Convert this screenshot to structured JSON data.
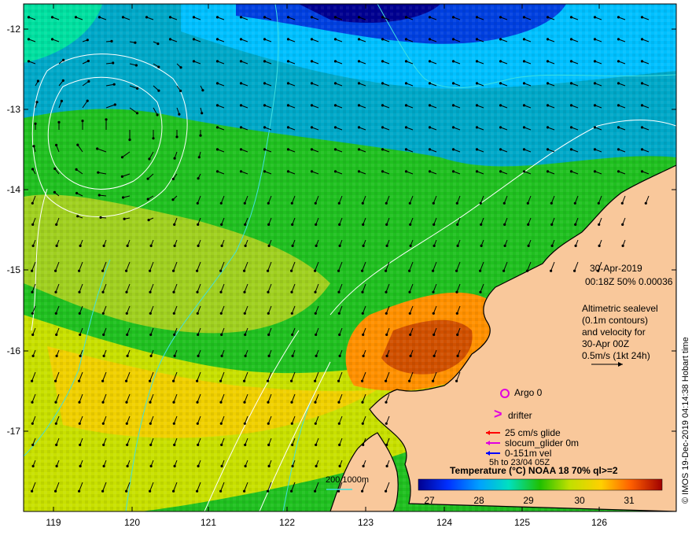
{
  "map": {
    "lon_ticks": [
      "119",
      "120",
      "121",
      "122",
      "123",
      "124",
      "125",
      "126"
    ],
    "lat_ticks": [
      "-12",
      "-13",
      "-14",
      "-15",
      "-16",
      "-17"
    ],
    "date": "30-Apr-2019",
    "time_info": "00:18Z  50% 0.00036",
    "altimetry_text": [
      "Altimetric sealevel",
      "(0.1m contours)",
      "and velocity for",
      "30-Apr 00Z",
      "0.5m/s (1kt 24h)"
    ],
    "legend": {
      "argo": "Argo 0",
      "drifter": "drifter",
      "glide": "25 cm/s glide",
      "slocum": "slocum_glider 0m",
      "vel": "0-151m vel",
      "vel_time": "5h to 23/04 05Z"
    },
    "isobath_label": "200  1000m",
    "colorbar": {
      "title": "Temperature (°C) NOAA 18 70% ql>=2",
      "ticks": [
        "27",
        "28",
        "29",
        "30",
        "31"
      ]
    },
    "credit": "© IMOS 19-Dec-2019 04:14:38 Hobart time",
    "colors": {
      "land": "#f9c89b",
      "coast": "#000000",
      "argo": "#e000e0",
      "drifter": "#e000e0",
      "glide": "#ff0000",
      "slocum": "#e000e0",
      "vel": "#0000ff",
      "isobath": "#40e0e0"
    }
  }
}
